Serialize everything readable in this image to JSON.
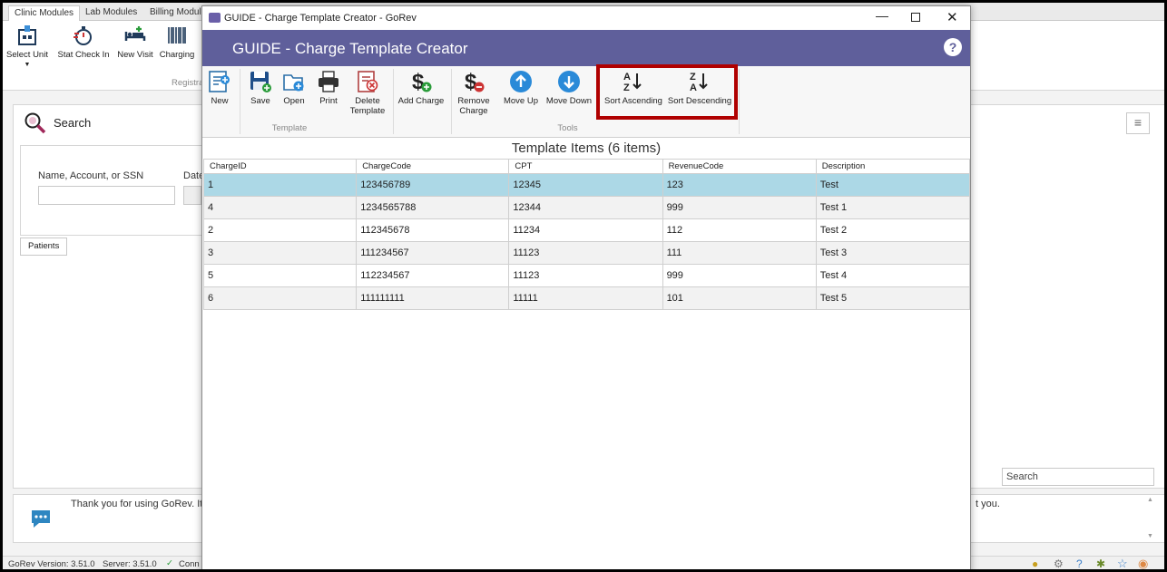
{
  "background_app": {
    "tabs": [
      "Clinic Modules",
      "Lab Modules",
      "Billing Modules"
    ],
    "ribbon_buttons": [
      "Select Unit",
      "Stat Check In",
      "New Visit",
      "Charging"
    ],
    "ribbon_group": "Registra",
    "search_title": "Search",
    "search_field_label": "Name, Account, or SSN",
    "date_label": "Date",
    "patients_tab": "Patients",
    "search_box_placeholder": "Search",
    "message_text": "Thank you for using GoRev.  It",
    "message_text_tail": "t you.",
    "status": {
      "version": "GoRev Version: 3.51.0",
      "server": "Server: 3.51.0",
      "connection": "Conn"
    }
  },
  "dialog": {
    "window_title": "GUIDE - Charge Template Creator - GoRev",
    "header_title": "GUIDE - Charge Template Creator",
    "help_label": "?",
    "ribbon": {
      "template_group": {
        "label": "Template",
        "buttons": {
          "new": "New",
          "save": "Save",
          "open": "Open",
          "print": "Print",
          "delete": "Delete Template"
        }
      },
      "tools_group": {
        "label": "Tools",
        "buttons": {
          "add_charge": "Add Charge",
          "remove_charge": "Remove Charge",
          "move_up": "Move Up",
          "move_down": "Move Down",
          "sort_ascending": "Sort Ascending",
          "sort_descending": "Sort Descending"
        }
      }
    },
    "highlight_color": "#b00000",
    "grid": {
      "title": "Template Items (6 items)",
      "columns": [
        "ChargeID",
        "ChargeCode",
        "CPT",
        "RevenueCode",
        "Description"
      ],
      "rows": [
        [
          "1",
          "123456789",
          "12345",
          "123",
          "Test"
        ],
        [
          "4",
          "1234565788",
          "12344",
          "999",
          "Test 1"
        ],
        [
          "2",
          "112345678",
          "11234",
          "112",
          "Test 2"
        ],
        [
          "3",
          "111234567",
          "11123",
          "111",
          "Test 3"
        ],
        [
          "5",
          "112234567",
          "11123",
          "999",
          "Test 4"
        ],
        [
          "6",
          "111111111",
          "11111",
          "101",
          "Test 5"
        ]
      ],
      "selected_row": 0
    }
  }
}
